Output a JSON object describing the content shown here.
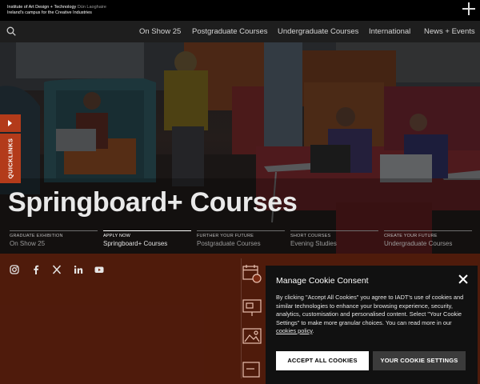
{
  "brand": {
    "line1_main": "Institute of Art Design + Technology",
    "line1_dim": "Dún Laoghaire",
    "line2": "Ireland's campus for the Creative Industries"
  },
  "nav": {
    "items": [
      "On Show 25",
      "Postgraduate Courses",
      "Undergraduate Courses",
      "International",
      "News + Events"
    ]
  },
  "hero": {
    "title": "Springboard+ Courses",
    "quicklinks_label": "QUICKLINKS",
    "promos": [
      {
        "kicker": "GRADUATE EXHIBITION",
        "label": "On Show 25"
      },
      {
        "kicker": "APPLY NOW",
        "label": "Springboard+ Courses"
      },
      {
        "kicker": "FURTHER YOUR FUTURE",
        "label": "Postgraduate Courses"
      },
      {
        "kicker": "SHORT COURSES",
        "label": "Evening Studies"
      },
      {
        "kicker": "CREATE YOUR FUTURE",
        "label": "Undergraduate Courses"
      }
    ]
  },
  "social": [
    "instagram-icon",
    "facebook-icon",
    "x-icon",
    "linkedin-icon",
    "youtube-icon"
  ],
  "side_icons": [
    "calendar-icon",
    "presentation-icon",
    "gallery-icon",
    "tablet-icon"
  ],
  "cookie": {
    "title": "Manage Cookie Consent",
    "body_before_link": "By clicking \"Accept All Cookies\" you agree to IADT's use of cookies and similar technologies to enhance your browsing experience, security, analytics, customisation and personalised content. Select \"Your Cookie Settings\" to make more granular choices. You can read more in our ",
    "link_text": "cookies policy",
    "body_after_link": ".",
    "accept_label": "ACCEPT ALL COOKIES",
    "settings_label": "YOUR COOKIE SETTINGS"
  },
  "colors": {
    "accent": "#b33b1a",
    "band": "#7a2a12",
    "dialog": "#111111"
  }
}
